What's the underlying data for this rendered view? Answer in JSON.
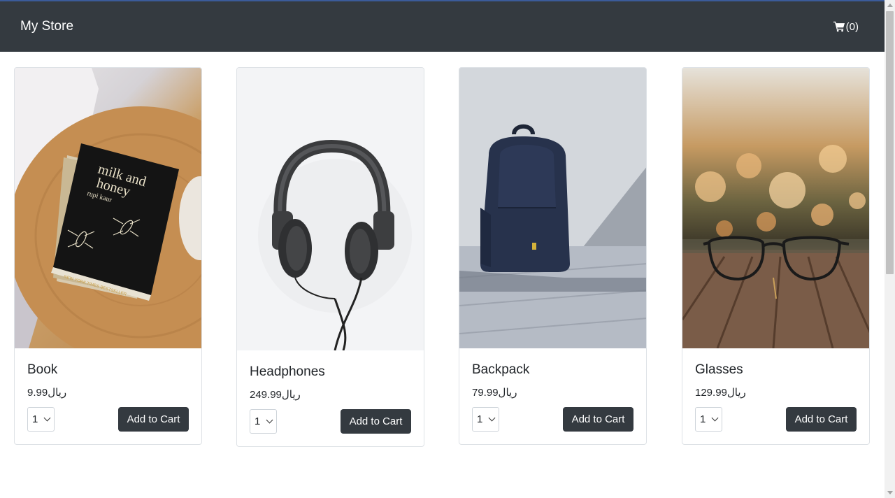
{
  "store": {
    "brand": "My Store",
    "cart_label": "(0)"
  },
  "products": [
    {
      "name": "Book",
      "price": "9.99ريال",
      "qty": "1",
      "button": "Add to Cart",
      "cover_title": "milk and honey",
      "cover_author": "rupi kaur",
      "cover_footer": "NEW YORK TIMES BESTSELLER"
    },
    {
      "name": "Headphones",
      "price": "249.99ريال",
      "qty": "1",
      "button": "Add to Cart"
    },
    {
      "name": "Backpack",
      "price": "79.99ريال",
      "qty": "1",
      "button": "Add to Cart"
    },
    {
      "name": "Glasses",
      "price": "129.99ريال",
      "qty": "1",
      "button": "Add to Cart"
    }
  ]
}
